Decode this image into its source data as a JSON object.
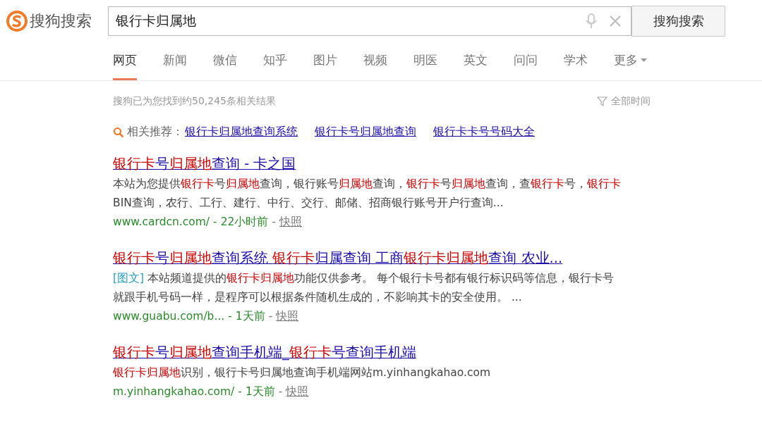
{
  "header": {
    "logo_text": "搜狗搜索",
    "query": "银行卡归属地",
    "search_button": "搜狗搜索"
  },
  "tabs": [
    {
      "label": "网页",
      "selected": true
    },
    {
      "label": "新闻",
      "selected": false
    },
    {
      "label": "微信",
      "selected": false
    },
    {
      "label": "知乎",
      "selected": false
    },
    {
      "label": "图片",
      "selected": false
    },
    {
      "label": "视频",
      "selected": false
    },
    {
      "label": "明医",
      "selected": false
    },
    {
      "label": "英文",
      "selected": false
    },
    {
      "label": "问问",
      "selected": false
    },
    {
      "label": "学术",
      "selected": false
    },
    {
      "label": "更多",
      "selected": false,
      "dropdown": true
    }
  ],
  "result_count": "搜狗已为您找到约50,245条相关结果",
  "time_filter": "全部时间",
  "related": {
    "label": "相关推荐：",
    "links": [
      "银行卡归属地查询系统",
      "银行卡号归属地查询",
      "银行卡卡号号码大全"
    ]
  },
  "results": [
    {
      "title": "**银行卡**号**归属地**查询 - 卡之国",
      "snippet": "本站为您提供**银行卡**号**归属地**查询，银行账号**归属地**查询，**银行卡**号**归属地**查询，查**银行卡**号，**银行卡**BIN查询，农行、工行、建行、中行、交行、邮储、招商银行账号开户行查询...",
      "url": "www.cardcn.com/",
      "separator_1": "-",
      "time": "22小时前",
      "separator_2": "-",
      "snapshot": "快照"
    },
    {
      "title": "**银行卡**号**归属地**查询系统 **银行卡**归属查询 工商**银行卡归属地**查询 农业...",
      "tag": "[图文]",
      "snippet": "本站频道提供的**银行卡归属地**功能仅供参考。 每个银行卡号都有银行标识码等信息，银行卡号就跟手机号码一样，是程序可以根据条件随机生成的，不影响其卡的安全使用。 ...",
      "url": "www.guabu.com/b...",
      "separator_1": "-",
      "time": "1天前",
      "separator_2": "-",
      "snapshot": "快照"
    },
    {
      "title": "**银行卡**号**归属地**查询手机端_**银行卡**号查询手机端",
      "snippet": "**银行卡归属地**识别，银行卡号归属地查询手机端网站m.yinhangkahao.com",
      "url": "m.yinhangkahao.com/",
      "separator_1": "-",
      "time": "1天前",
      "separator_2": "-",
      "snapshot": "快照"
    }
  ]
}
